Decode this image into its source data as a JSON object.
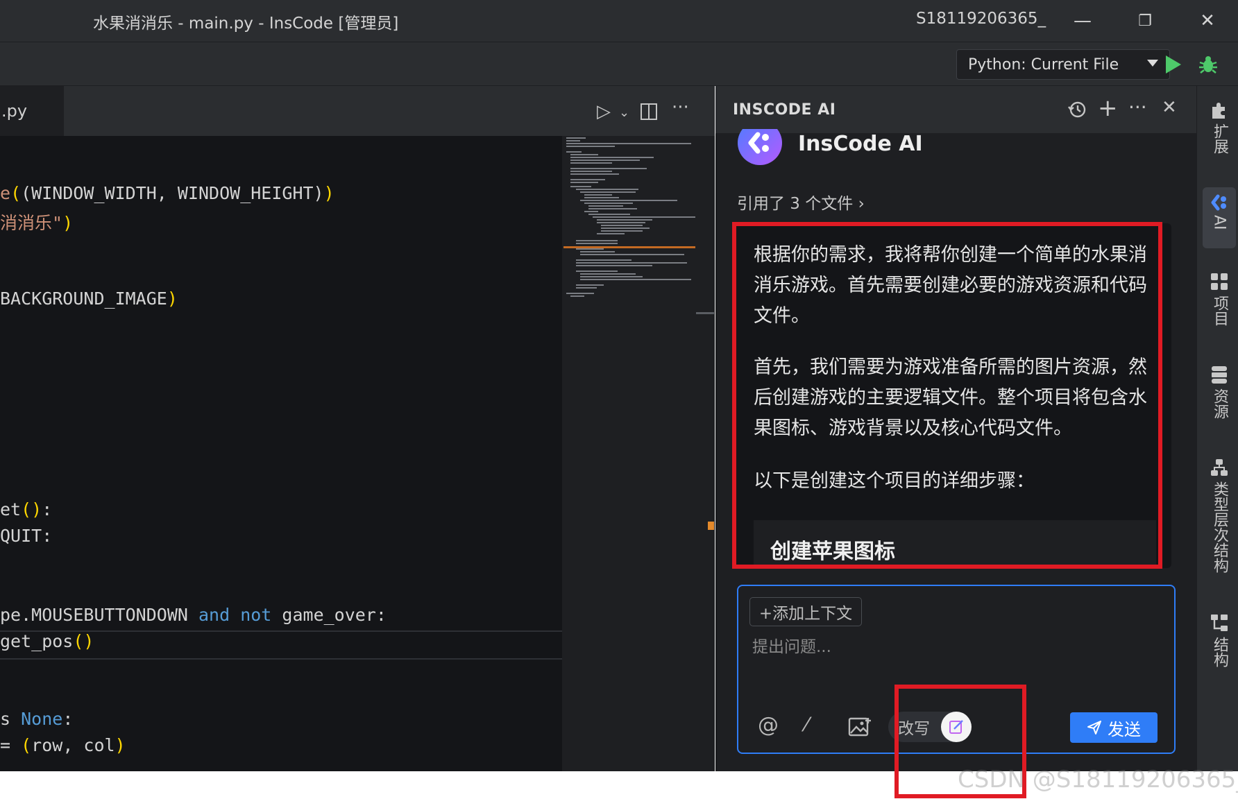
{
  "titlebar": {
    "title": "水果消消乐 - main.py - InsCode [管理员]",
    "account": "S18119206365_",
    "minimize": "—",
    "restore": "❐",
    "close": "✕"
  },
  "toolbar": {
    "run_config": "Python: Current File"
  },
  "editor": {
    "tab_label": ".py",
    "code_lines": {
      "l1_a": "e",
      "l1_b": "(",
      "l1_c": "(WINDOW_WIDTH, WINDOW_HEIGHT)",
      "l1_d": ")",
      "l2_a": "消消乐\"",
      "l2_b": ")",
      "l3_a": "BACKGROUND_IMAGE",
      "l3_b": ")",
      "l4_a": "et",
      "l4_b": "()",
      "l4_c": ":",
      "l5": "QUIT:",
      "l6_a": "pe.MOUSEBUTTONDOWN ",
      "l6_and": "and",
      "l6_not": "not",
      "l6_b": " game_over:",
      "l7_a": "get_pos",
      "l7_b": "()",
      "l8_a": "s ",
      "l8_none": "None",
      "l8_b": ":",
      "l9_a": "= ",
      "l9_b": "(",
      "l9_c": "row, col",
      "l9_d": ")"
    }
  },
  "ai_panel": {
    "header_title": "INSCODE AI",
    "assistant_name": "InsCode AI",
    "cited_files": "引用了 3 个文件 ›",
    "paragraphs": [
      "根据你的需求，我将帮你创建一个简单的水果消消乐游戏。首先需要创建必要的游戏资源和代码文件。",
      "首先，我们需要为游戏准备所需的图片资源，然后创建游戏的主要逻辑文件。整个项目将包含水果图标、游戏背景以及核心代码文件。",
      "以下是创建这个项目的详细步骤："
    ],
    "section_heading": "创建苹果图标",
    "add_context": "+添加上下文",
    "input_placeholder": "提出问题...",
    "rewrite_label": "改写",
    "send_label": "发送",
    "at_symbol": "@",
    "slash_symbol": "⁄"
  },
  "right_strip": {
    "items": [
      {
        "label": "扩展",
        "icon": "puzzle-icon"
      },
      {
        "label": "AI",
        "icon": "ai-logo-icon"
      },
      {
        "label": "项目",
        "icon": "project-icon"
      },
      {
        "label": "资源",
        "icon": "database-icon"
      },
      {
        "label": "类型层次结构",
        "icon": "hierarchy-icon"
      },
      {
        "label": "结构",
        "icon": "structure-icon"
      }
    ]
  },
  "watermark": "CSDN @S18119206365_",
  "colors": {
    "accent_blue": "#2f7df7",
    "annotation_red": "#e01b24",
    "run_green": "#4ec96a"
  }
}
